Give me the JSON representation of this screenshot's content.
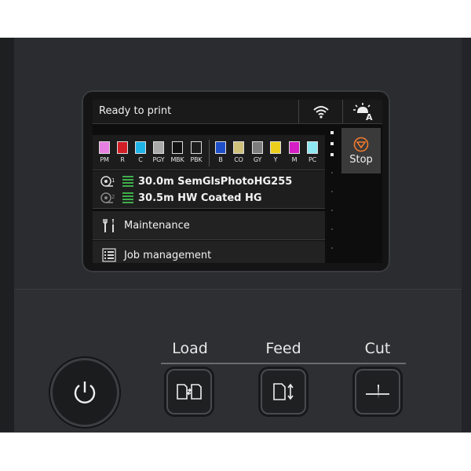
{
  "screen": {
    "status_text": "Ready to print",
    "icons": {
      "network": "wifi-icon",
      "auto_clean": "auto-cleaning-icon"
    },
    "inks_left": [
      {
        "label": "PM",
        "color": "#e77fe0"
      },
      {
        "label": "R",
        "color": "#d21f27"
      },
      {
        "label": "C",
        "color": "#1fb4e8"
      },
      {
        "label": "PGY",
        "color": "#a9a9a9"
      },
      {
        "label": "MBK",
        "color": "#111111"
      },
      {
        "label": "PBK",
        "color": "#1c1c1c"
      }
    ],
    "inks_right": [
      {
        "label": "B",
        "color": "#1f4fc8"
      },
      {
        "label": "CO",
        "color": "#cfc07a"
      },
      {
        "label": "GY",
        "color": "#7d7d7d"
      },
      {
        "label": "Y",
        "color": "#e9cf1b"
      },
      {
        "label": "M",
        "color": "#d51ec6"
      },
      {
        "label": "PC",
        "color": "#8ee7f1"
      }
    ],
    "media": {
      "roll1": "30.0m  SemGlsPhotoHG255",
      "roll2": "30.5m  HW Coated HG"
    },
    "menu": {
      "maintenance": "Maintenance",
      "job_management": "Job management"
    },
    "stop_label": "Stop"
  },
  "buttons": {
    "load_label": "Load",
    "feed_label": "Feed",
    "cut_label": "Cut"
  }
}
